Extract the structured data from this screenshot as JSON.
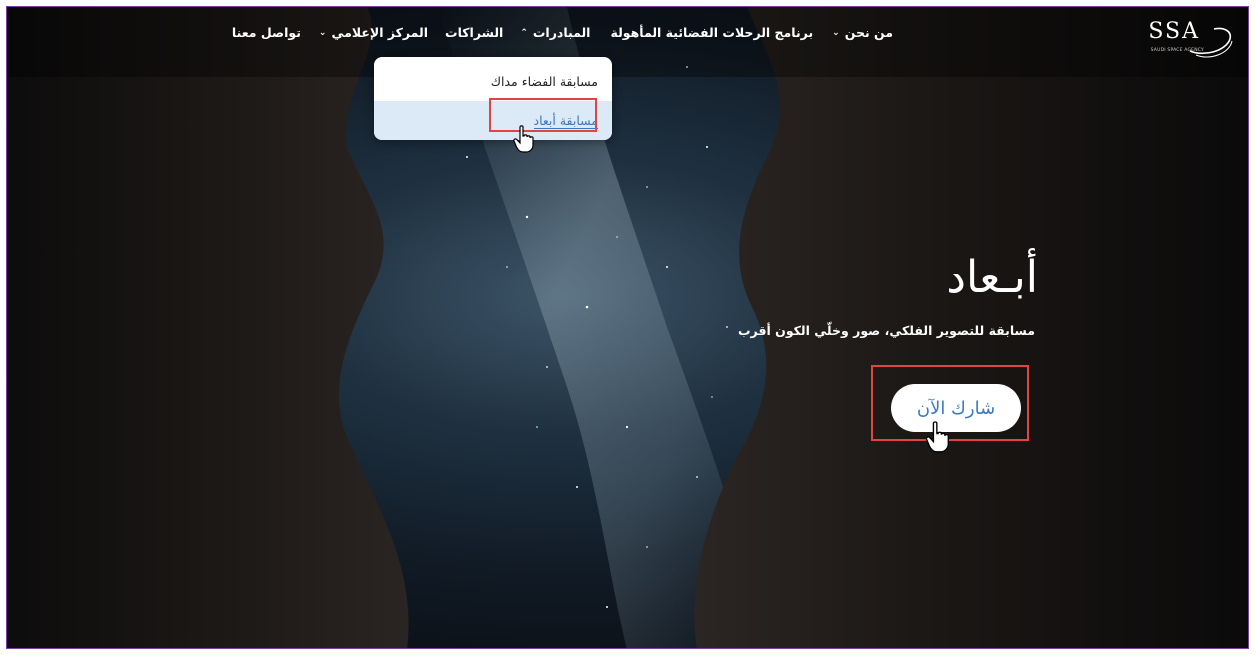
{
  "brand": {
    "logo_text": "SSA",
    "logo_subtitle": "SAUDI SPACE AGENCY"
  },
  "nav": {
    "items": [
      {
        "label": "من نحن",
        "has_dropdown": true
      },
      {
        "label": "برنامج الرحلات الفضائية المأهولة",
        "has_dropdown": false
      },
      {
        "label": "المبادرات",
        "has_dropdown": true,
        "expanded": true
      },
      {
        "label": "الشراكات",
        "has_dropdown": false
      },
      {
        "label": "المركز الإعلامي",
        "has_dropdown": true
      },
      {
        "label": "تواصل معنا",
        "has_dropdown": false
      }
    ]
  },
  "dropdown": {
    "items": [
      {
        "label": "مسابقة الفضاء مداك"
      },
      {
        "label": "مسابقة أبعاد",
        "hovered": true
      }
    ]
  },
  "hero": {
    "title": "أبـعاد",
    "subtitle": "مسابقة للتصوير الفلكي، صور وخلّي الكون أقرب",
    "cta_label": "شارك الآن"
  },
  "colors": {
    "accent": "#3b79c4",
    "highlight": "#e04545",
    "frame": "#7a3fa0",
    "dropdown_hover_bg": "#dce9f6"
  },
  "icons": [
    "logo-swoosh-icon",
    "chevron-down-icon",
    "chevron-up-icon",
    "hand-pointer-icon"
  ]
}
